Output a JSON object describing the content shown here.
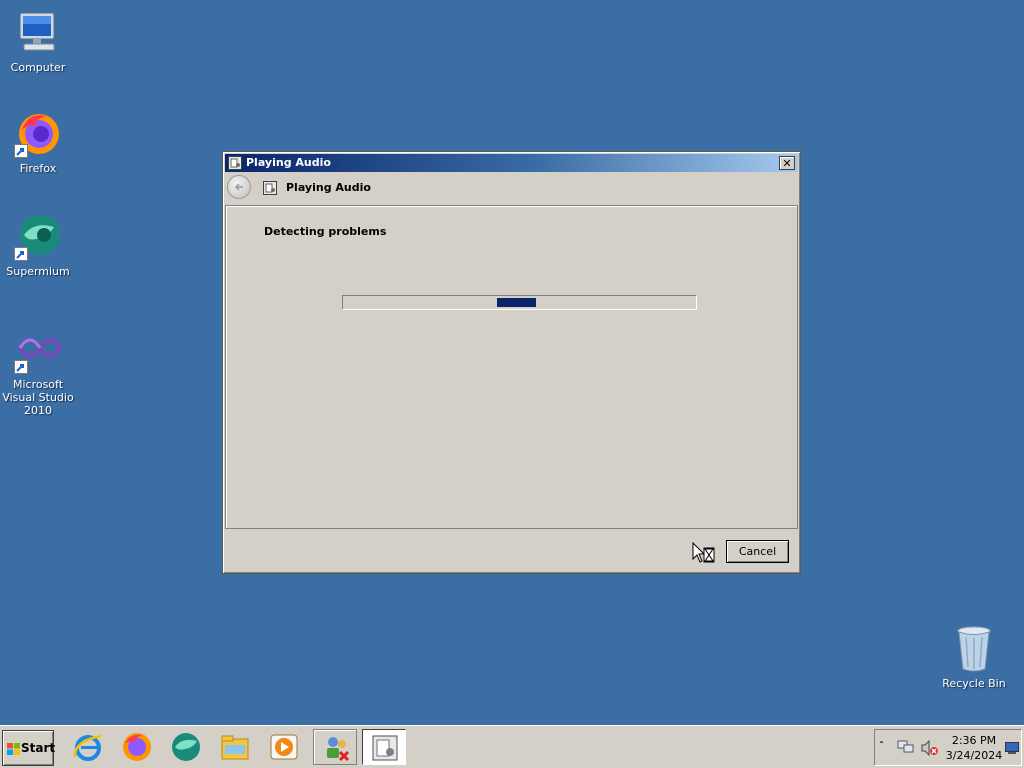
{
  "desktop": {
    "icons": [
      {
        "label": "Computer",
        "icon": "computer-icon"
      },
      {
        "label": "Firefox",
        "icon": "firefox-icon"
      },
      {
        "label": "Supermium",
        "icon": "supermium-icon"
      },
      {
        "label": "Microsoft Visual Studio 2010",
        "icon": "visual-studio-icon"
      },
      {
        "label": "Recycle Bin",
        "icon": "recycle-bin-icon"
      }
    ]
  },
  "dialog": {
    "title": "Playing Audio",
    "nav_title": "Playing Audio",
    "status": "Detecting problems",
    "cancel_label": "Cancel",
    "progress_style": "marquee",
    "close_glyph": "✕"
  },
  "taskbar": {
    "start_label": "Start",
    "pinned": [
      {
        "name": "internet-explorer-icon"
      },
      {
        "name": "firefox-icon"
      },
      {
        "name": "supermium-icon"
      },
      {
        "name": "file-explorer-icon"
      },
      {
        "name": "media-player-icon"
      },
      {
        "name": "network-troubleshooter-icon"
      },
      {
        "name": "playing-audio-task-icon"
      }
    ],
    "clock": {
      "time": "2:36 PM",
      "date": "3/24/2024"
    }
  },
  "colors": {
    "desktop": "#3a6ea5",
    "title_start": "#0a246a",
    "title_end": "#a6caf0",
    "progress": "#0a246a",
    "face": "#d4d0c8"
  }
}
